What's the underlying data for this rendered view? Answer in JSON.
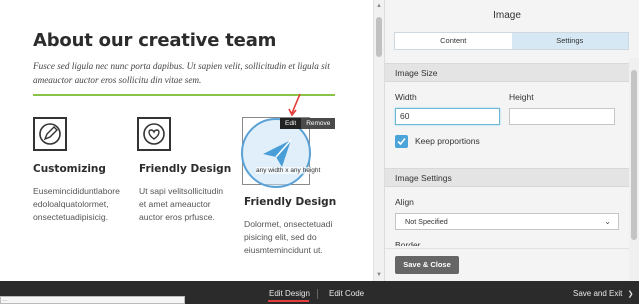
{
  "canvas": {
    "heading": "About our creative team",
    "intro": "Fusce sed ligula nec nunc porta dapibus. Ut sapien velit, sollicitudin et ligula sit ameauctor auctor eros sollicitu din vitae sem.",
    "features": [
      {
        "icon": "pencil-icon",
        "title": "Customizing",
        "body": [
          "Eusemincididuntlabore",
          "edoloalquatolormet,",
          "onsectetuadipisicig."
        ]
      },
      {
        "icon": "heart-icon",
        "title": "Friendly Design",
        "body": [
          "Ut sapi velitsollicitudin",
          "et amet ameauctor",
          "auctor eros prfusce."
        ]
      },
      {
        "icon": "paper-plane-icon",
        "title": "Friendly Design",
        "body": [
          "Dolormet, onsectetuadi",
          "pisicing elit, sed do",
          "eiusmtemincidunt ut."
        ]
      }
    ],
    "selected_image": {
      "size_note": "any width x any height",
      "edit_label": "Edit",
      "remove_label": "Remove"
    }
  },
  "panel": {
    "title": "Image",
    "tabs": [
      {
        "label": "Content",
        "active": false
      },
      {
        "label": "Settings",
        "active": true
      }
    ],
    "image_size": {
      "section_title": "Image Size",
      "width_label": "Width",
      "width_value": "60",
      "height_label": "Height",
      "height_value": "",
      "keep_proportions_label": "Keep proportions",
      "keep_proportions_checked": true
    },
    "image_settings": {
      "section_title": "Image Settings",
      "align_label": "Align",
      "align_value": "Not Specified",
      "border_label": "Border"
    },
    "save_close_label": "Save & Close"
  },
  "bottom_bar": {
    "status_tip": "...",
    "edit_design": "Edit Design",
    "edit_code": "Edit Code",
    "save_exit": "Save and Exit",
    "save_exit_chevron": "❯"
  },
  "colors": {
    "accent_green": "#8bc34a",
    "active_tab": "#d5e8f3",
    "checkbox_blue": "#4aa3d9",
    "bottom_bar": "#2b2b2b",
    "active_underline": "#e43d3d"
  }
}
